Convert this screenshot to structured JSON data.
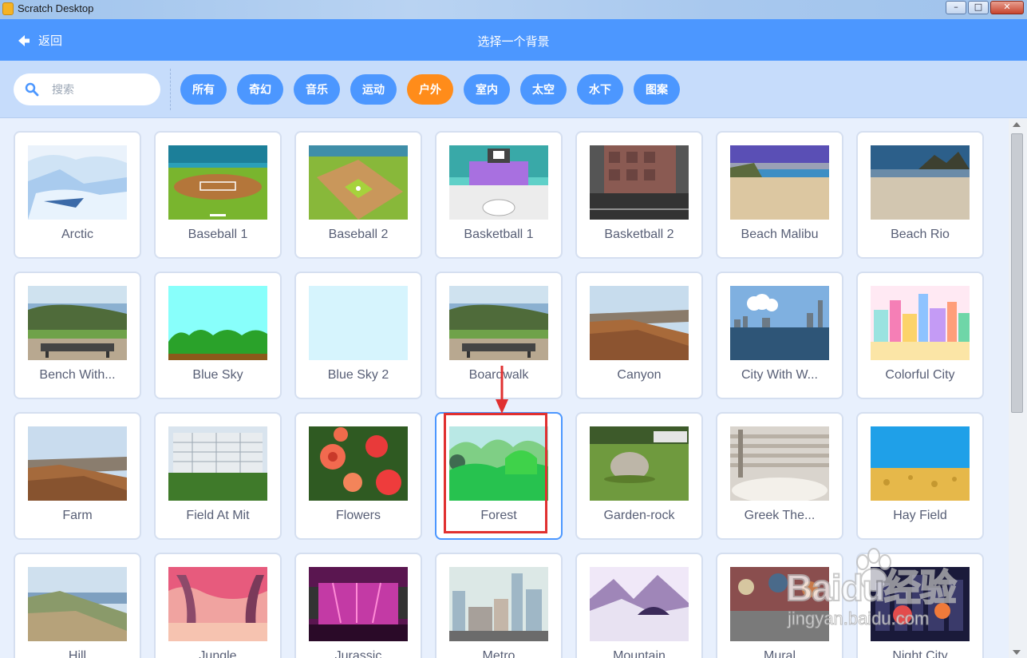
{
  "window": {
    "title": "Scratch Desktop"
  },
  "header": {
    "back_label": "返回",
    "title": "选择一个背景"
  },
  "search": {
    "placeholder": "搜索"
  },
  "tags": [
    {
      "label": "所有",
      "active": false
    },
    {
      "label": "奇幻",
      "active": false
    },
    {
      "label": "音乐",
      "active": false
    },
    {
      "label": "运动",
      "active": false
    },
    {
      "label": "户外",
      "active": true
    },
    {
      "label": "室内",
      "active": false
    },
    {
      "label": "太空",
      "active": false
    },
    {
      "label": "水下",
      "active": false
    },
    {
      "label": "图案",
      "active": false
    }
  ],
  "backdrops": [
    {
      "name": "Arctic",
      "icon": "arctic-scene"
    },
    {
      "name": "Baseball 1",
      "icon": "baseball-field"
    },
    {
      "name": "Baseball 2",
      "icon": "baseball-diamond"
    },
    {
      "name": "Basketball 1",
      "icon": "basketball-court"
    },
    {
      "name": "Basketball 2",
      "icon": "basketball-outdoor"
    },
    {
      "name": "Beach Malibu",
      "icon": "beach"
    },
    {
      "name": "Beach Rio",
      "icon": "beach-mountain"
    },
    {
      "name": "Bench With...",
      "icon": "bench-view"
    },
    {
      "name": "Blue Sky",
      "icon": "blue-sky"
    },
    {
      "name": "Blue Sky 2",
      "icon": "blue-sky-plain"
    },
    {
      "name": "Boardwalk",
      "icon": "bench-view"
    },
    {
      "name": "Canyon",
      "icon": "canyon"
    },
    {
      "name": "City With W...",
      "icon": "city-water"
    },
    {
      "name": "Colorful City",
      "icon": "colorful-city"
    },
    {
      "name": "Farm",
      "icon": "farm"
    },
    {
      "name": "Field At Mit",
      "icon": "field-building"
    },
    {
      "name": "Flowers",
      "icon": "flowers"
    },
    {
      "name": "Forest",
      "icon": "forest",
      "selected": true
    },
    {
      "name": "Garden-rock",
      "icon": "garden-rock"
    },
    {
      "name": "Greek The...",
      "icon": "greek-theater"
    },
    {
      "name": "Hay Field",
      "icon": "hay-field"
    },
    {
      "name": "Hill",
      "icon": "hill"
    },
    {
      "name": "Jungle",
      "icon": "jungle"
    },
    {
      "name": "Jurassic",
      "icon": "stage"
    },
    {
      "name": "Metro",
      "icon": "metro-city"
    },
    {
      "name": "Mountain",
      "icon": "snow-mountain"
    },
    {
      "name": "Mural",
      "icon": "mural"
    },
    {
      "name": "Night City",
      "icon": "night-city"
    }
  ],
  "watermark": {
    "logo": "Baidu经验",
    "sub": "jingyan.baidu.com"
  }
}
